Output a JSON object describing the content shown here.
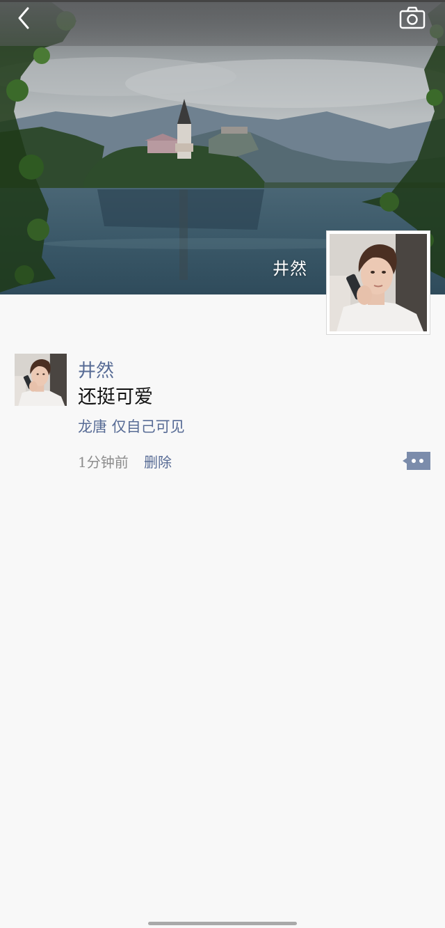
{
  "cover": {
    "name": "井然"
  },
  "top_bar": {
    "back_icon": "chevron-left-icon",
    "camera_icon": "camera-icon"
  },
  "post": {
    "author": "井然",
    "text": "还挺可爱",
    "visibility": "龙唐 仅自己可见",
    "time": "1分钟前",
    "delete_label": "删除",
    "more_icon": "more-dots-icon"
  },
  "colors": {
    "link": "#576b95",
    "background": "#f8f8f8",
    "text": "#111111",
    "muted": "#8c8c8c"
  }
}
